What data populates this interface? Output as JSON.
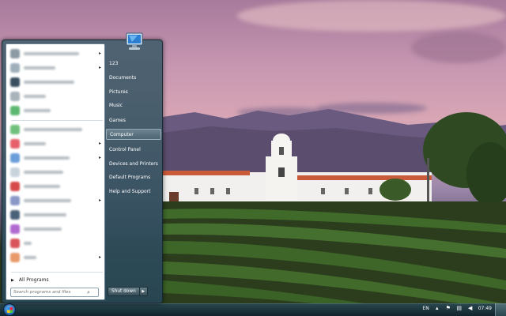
{
  "start_menu": {
    "right_items": [
      {
        "label": "123"
      },
      {
        "label": "Documents"
      },
      {
        "label": "Pictures"
      },
      {
        "label": "Music"
      },
      {
        "label": "Games"
      },
      {
        "label": "Computer"
      },
      {
        "label": "Control Panel"
      },
      {
        "label": "Devices and Printers"
      },
      {
        "label": "Default Programs"
      },
      {
        "label": "Help and Support"
      }
    ],
    "all_programs_label": "All Programs",
    "search_placeholder": "Search programs and files",
    "shutdown_label": "Shut down"
  },
  "tray": {
    "language": "EN",
    "clock": "07:49"
  },
  "colors": {
    "menu_glass": "#3e6170",
    "accent_blue": "#2a6fb8"
  }
}
